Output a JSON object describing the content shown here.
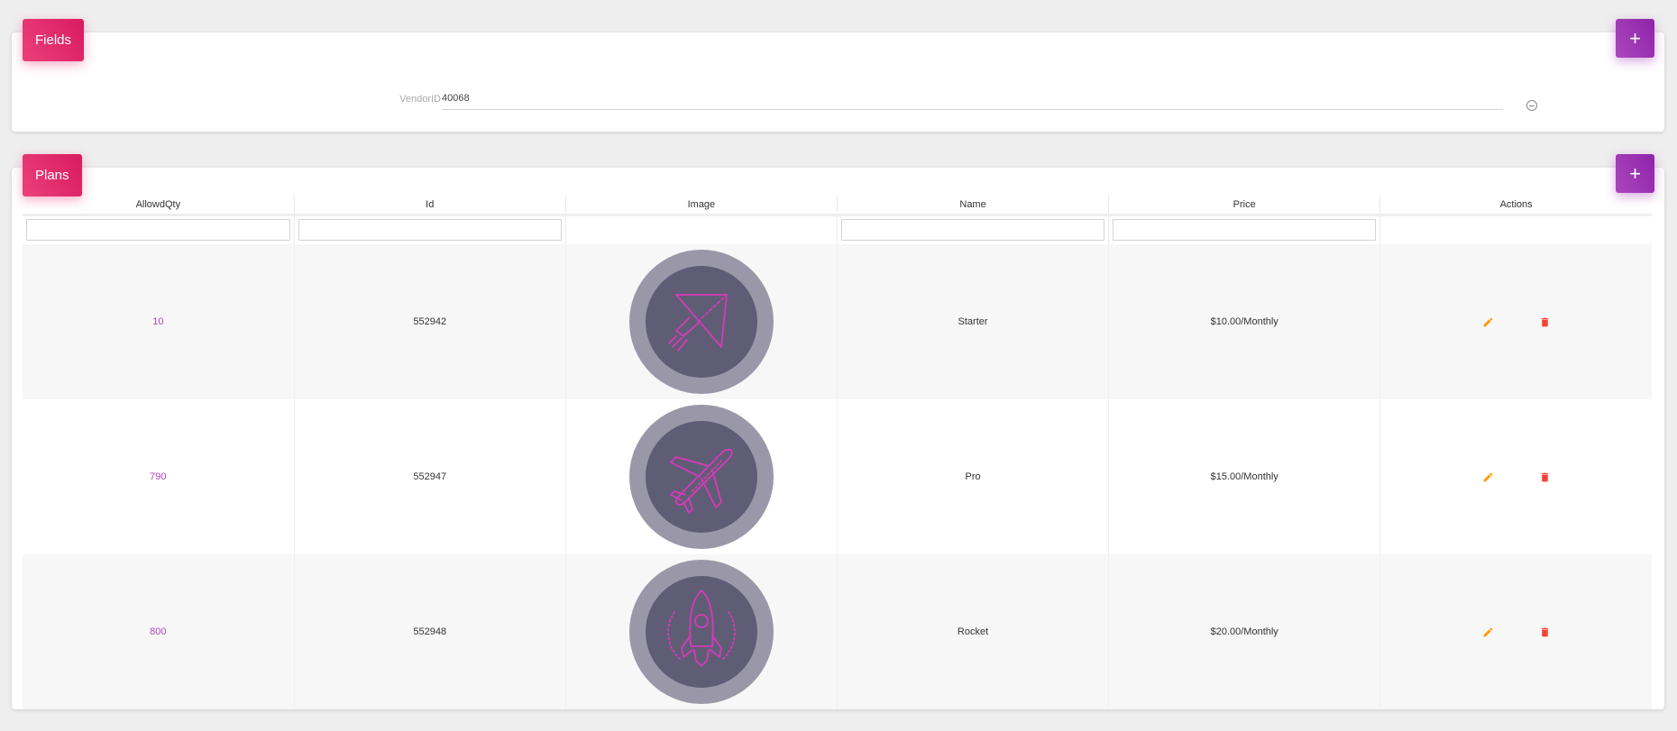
{
  "fields_card": {
    "title": "Fields",
    "add_label": "+",
    "vendor_label": "VendorID",
    "vendor_value": "40068"
  },
  "plans_card": {
    "title": "Plans",
    "add_label": "+",
    "columns": [
      "AllowdQty",
      "Id",
      "Image",
      "Name",
      "Price",
      "Actions"
    ],
    "rows": [
      {
        "qty": "10",
        "id": "552942",
        "image_icon": "paper-plane-icon",
        "name": "Starter",
        "price": "$10.00/Monthly"
      },
      {
        "qty": "790",
        "id": "552947",
        "image_icon": "airplane-icon",
        "name": "Pro",
        "price": "$15.00/Monthly"
      },
      {
        "qty": "800",
        "id": "552948",
        "image_icon": "rocket-icon",
        "name": "Rocket",
        "price": "$20.00/Monthly"
      }
    ]
  },
  "colors": {
    "badge_pink": "#e91e63",
    "add_purple": "#9c27b0",
    "qty_text": "#ab47bc",
    "edit_orange": "#ff9800",
    "delete_red": "#f44336",
    "icon_magenta": "#d63ab8",
    "circle_outer": "#9a98a8",
    "circle_inner": "#5f5d75"
  }
}
